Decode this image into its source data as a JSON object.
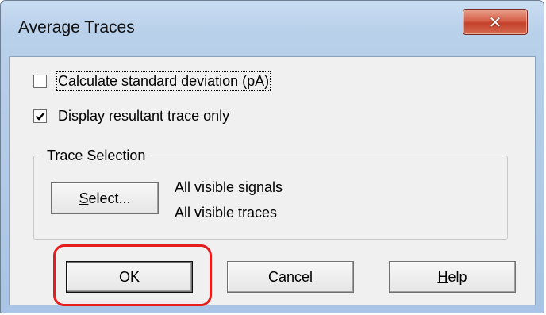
{
  "dialog": {
    "title": "Average Traces",
    "close_icon": "close-x-icon",
    "accent_close_color": "#d7614a",
    "highlight_color": "#e81c1c"
  },
  "options": {
    "calc_std": {
      "label": "Calculate standard deviation (pA)",
      "checked": false
    },
    "display_resultant": {
      "label": "Display resultant trace only",
      "checked": true
    }
  },
  "trace_selection": {
    "title": "Trace Selection",
    "select_button": {
      "mnemonic": "S",
      "rest": "elect..."
    },
    "signals_text": "All visible signals",
    "traces_text": "All visible traces"
  },
  "buttons": {
    "ok": "OK",
    "cancel": "Cancel",
    "help": {
      "mnemonic": "H",
      "rest": "elp"
    }
  }
}
